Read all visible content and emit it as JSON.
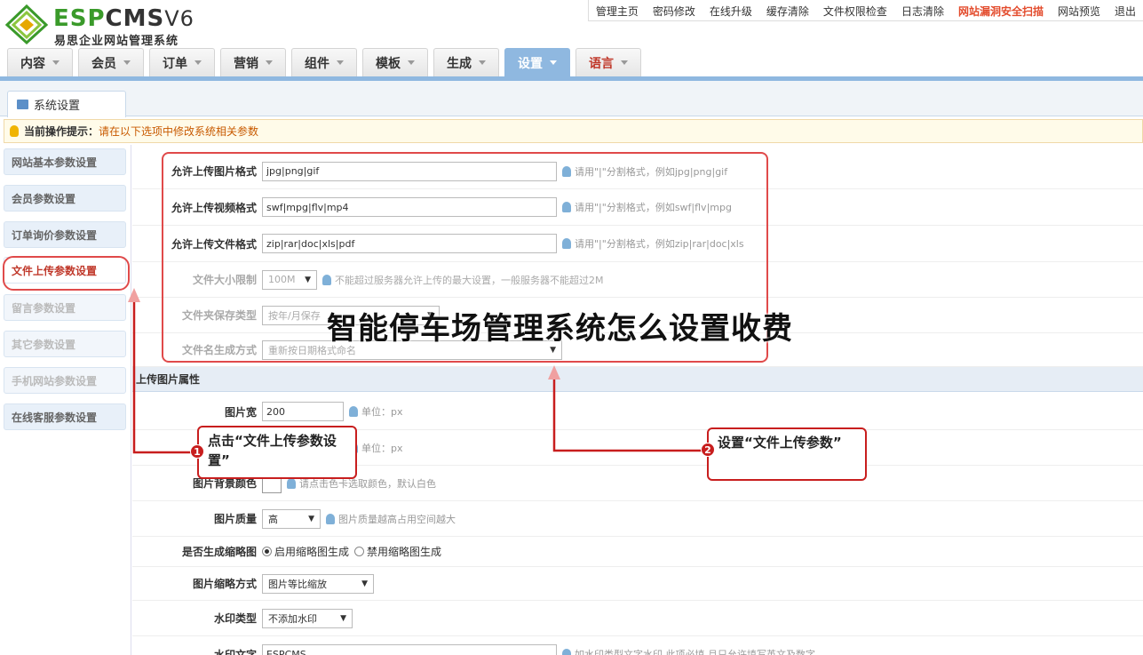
{
  "header": {
    "logo_main_green": "ESP",
    "logo_main_dark": "CMS",
    "logo_version": "V6",
    "logo_sub": "易思企业网站管理系统",
    "top_links": [
      "管理主页",
      "密码修改",
      "在线升级",
      "缓存清除",
      "文件权限检查",
      "日志清除",
      "网站漏洞安全扫描",
      "网站预览",
      "退出"
    ],
    "hot_link_index": 6,
    "main_tabs": [
      "内容",
      "会员",
      "订单",
      "营销",
      "组件",
      "模板",
      "生成",
      "设置",
      "语言"
    ],
    "active_tab": "设置",
    "lang_tab": "语言"
  },
  "subtab": {
    "label": "系统设置"
  },
  "tip": {
    "label": "当前操作提示：",
    "message": "请在以下选项中修改系统相关参数"
  },
  "sidebar": {
    "items": [
      {
        "label": "网站基本参数设置",
        "state": "normal"
      },
      {
        "label": "会员参数设置",
        "state": "normal"
      },
      {
        "label": "订单询价参数设置",
        "state": "normal"
      },
      {
        "label": "文件上传参数设置",
        "state": "active"
      },
      {
        "label": "留言参数设置",
        "state": "faded"
      },
      {
        "label": "其它参数设置",
        "state": "faded"
      },
      {
        "label": "手机网站参数设置",
        "state": "faded"
      },
      {
        "label": "在线客服参数设置",
        "state": "normal"
      }
    ]
  },
  "form": {
    "img_formats": {
      "label": "允许上传图片格式",
      "value": "jpg|png|gif",
      "help": "请用\"|\"分割格式，例如jpg|png|gif"
    },
    "video_formats": {
      "label": "允许上传视频格式",
      "value": "swf|mpg|flv|mp4",
      "help": "请用\"|\"分割格式，例如swf|flv|mpg"
    },
    "file_formats": {
      "label": "允许上传文件格式",
      "value": "zip|rar|doc|xls|pdf",
      "help": "请用\"|\"分割格式，例如zip|rar|doc|xls"
    },
    "size_limit": {
      "label": "文件大小限制",
      "value": "100M",
      "help": "不能超过服务器允许上传的最大设置，一般服务器不能超过2M"
    },
    "folder_type": {
      "label": "文件夹保存类型",
      "value": "按年/月保存"
    },
    "name_mode": {
      "label": "文件名生成方式",
      "value": "重新按日期格式命名"
    },
    "section_title": "上传图片属性",
    "img_width": {
      "label": "图片宽",
      "value": "200",
      "help": "单位：px"
    },
    "img_height": {
      "help": "单位：px"
    },
    "bg_color": {
      "label": "图片背景颜色",
      "help": "请点击色卡选取颜色，默认白色"
    },
    "quality": {
      "label": "图片质量",
      "value": "高",
      "help": "图片质量越高占用空间越大"
    },
    "thumb": {
      "label": "是否生成缩略图",
      "opt_on": "启用缩略图生成",
      "opt_off": "禁用缩略图生成"
    },
    "thumb_mode": {
      "label": "图片缩略方式",
      "value": "图片等比缩放"
    },
    "watermark_type": {
      "label": "水印类型",
      "value": "不添加水印"
    },
    "watermark_text": {
      "label": "水印文字",
      "value": "ESPCMS",
      "help": "如水印类型文字水印,此项必填,且只允许填写英文及数字"
    }
  },
  "annotations": {
    "callout1": "点击“文件上传参数设置”",
    "callout1_num": "1",
    "callout2": "设置“文件上传参数”",
    "callout2_num": "2",
    "overlay_title": "智能停车场管理系统怎么设置收费",
    "color_red": "#c81e1e",
    "color_pink": "#e04a4a"
  }
}
